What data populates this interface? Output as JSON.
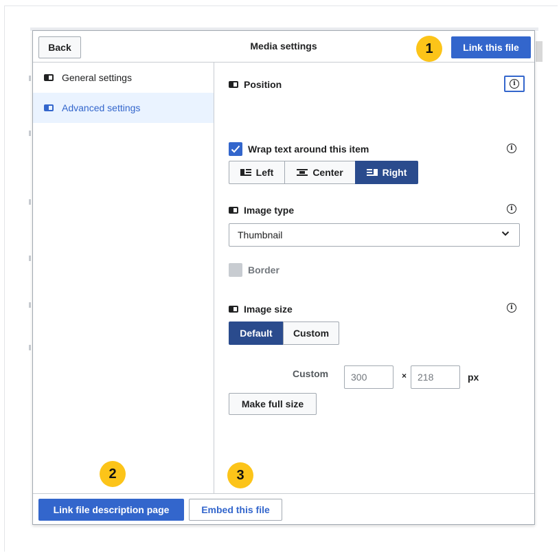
{
  "header": {
    "back_label": "Back",
    "title": "Media settings",
    "primary_label": "Link this file"
  },
  "sidebar": {
    "items": [
      {
        "label": "General settings",
        "icon": "toggle-pill-icon",
        "selected": false
      },
      {
        "label": "Advanced settings",
        "icon": "toggle-pill-icon",
        "selected": true
      }
    ]
  },
  "position": {
    "label": "Position",
    "wrap_label": "Wrap text around this item",
    "wrap_checked": true,
    "align_options": [
      "Left",
      "Center",
      "Right"
    ],
    "align_selected": "Right"
  },
  "image_type": {
    "label": "Image type",
    "selected": "Thumbnail",
    "border_label": "Border",
    "border_checked": false
  },
  "image_size": {
    "label": "Image size",
    "options": [
      "Default",
      "Custom"
    ],
    "selected": "Default",
    "custom_label": "Custom",
    "width_placeholder": "300",
    "height_placeholder": "218",
    "times": "×",
    "unit": "px",
    "full_size_label": "Make full size"
  },
  "footer": {
    "primary_label": "Link file description page",
    "secondary_label": "Embed this file"
  },
  "badges": [
    "1",
    "2",
    "3"
  ],
  "colors": {
    "accent": "#3366cc",
    "active_segment": "#2a4b8d",
    "badge": "#fcc419",
    "sidebar_selected_bg": "#eaf3ff"
  }
}
